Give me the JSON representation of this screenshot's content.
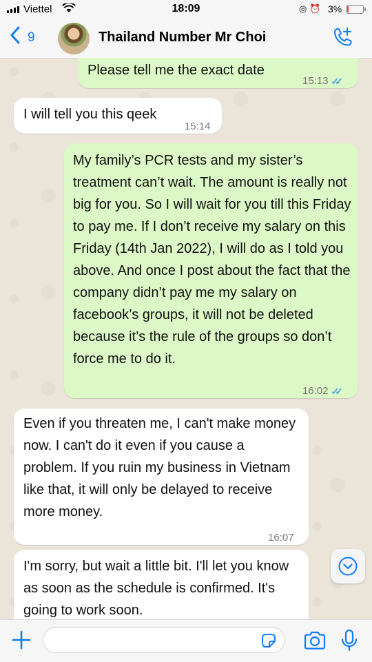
{
  "status_bar": {
    "carrier": "Viettel",
    "time": "18:09",
    "battery": "3%"
  },
  "header": {
    "back_count": "9",
    "contact_name": "Thailand Number Mr Choi"
  },
  "messages": [
    {
      "direction": "out",
      "text": "Please tell me the exact date",
      "time": "15:13",
      "status": "read"
    },
    {
      "direction": "in",
      "text": "I will tell you this qeek",
      "time": "15:14"
    },
    {
      "direction": "out",
      "text": "My family’s PCR tests and my sister’s treatment can’t wait. The amount is really not big for you. So I will wait for you till this Friday to pay me. If I don’t receive my salary on this Friday (14th Jan 2022), I will do as I told you above. And once I post about the fact that the company didn’t pay me my salary on facebook’s groups, it will not be deleted because it’s the rule of the groups so don’t force me to do it.",
      "time": "16:02",
      "status": "read"
    },
    {
      "direction": "in",
      "text": "Even if you threaten me, I can't make money now. I can't do it even if you cause a problem. If you ruin my business in Vietnam like that, it will only be delayed to receive more money.",
      "time": "16:07"
    },
    {
      "direction": "in",
      "text": "I'm sorry, but wait a little bit. I'll let you know as soon as the schedule is confirmed. It's going to work soon.",
      "time": ""
    }
  ],
  "input": {
    "placeholder": "",
    "value": ""
  },
  "colors": {
    "accent": "#0a7cff",
    "outgoing_bubble": "#dcf8c6",
    "incoming_bubble": "#ffffff",
    "read_ticks": "#4fa3e0"
  }
}
